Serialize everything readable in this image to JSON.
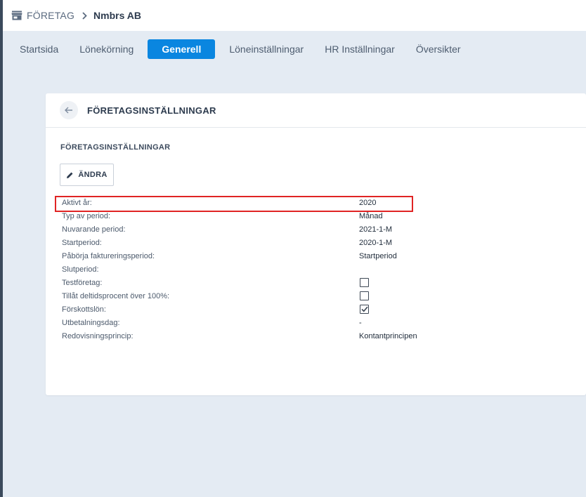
{
  "breadcrumb": {
    "root": "FÖRETAG",
    "current": "Nmbrs AB"
  },
  "tabs": [
    {
      "label": "Startsida",
      "active": false
    },
    {
      "label": "Lönekörning",
      "active": false
    },
    {
      "label": "Generell",
      "active": true
    },
    {
      "label": "Löneinställningar",
      "active": false
    },
    {
      "label": "HR Inställningar",
      "active": false
    },
    {
      "label": "Översikter",
      "active": false
    }
  ],
  "card": {
    "title": "FÖRETAGSINSTÄLLNINGAR",
    "section_title": "FÖRETAGSINSTÄLLNINGAR",
    "edit_label": "ÄNDRA"
  },
  "settings": [
    {
      "label": "Aktivt år:",
      "value": "2020"
    },
    {
      "label": "Typ av period:",
      "value": "Månad"
    },
    {
      "label": "Nuvarande period:",
      "value": "2021-1-M"
    },
    {
      "label": "Startperiod:",
      "value": "2020-1-M"
    },
    {
      "label": "Påbörja faktureringsperiod:",
      "value": "Startperiod"
    },
    {
      "label": "Slutperiod:",
      "value": ""
    },
    {
      "label": "Testföretag:",
      "checkbox": true,
      "checked": false
    },
    {
      "label": "Tillåt deltidsprocent över 100%:",
      "checkbox": true,
      "checked": false
    },
    {
      "label": "Förskottslön:",
      "checkbox": true,
      "checked": true
    },
    {
      "label": "Utbetalningsdag:",
      "value": "-"
    },
    {
      "label": "Redovisningsprincip:",
      "value": "Kontantprincipen"
    }
  ],
  "colors": {
    "accent": "#0a86e0",
    "highlight": "#e02424",
    "background": "#e4ebf3"
  },
  "icons": {
    "breadcrumb": "store-icon",
    "back": "arrow-left-icon",
    "edit": "pencil-icon"
  }
}
